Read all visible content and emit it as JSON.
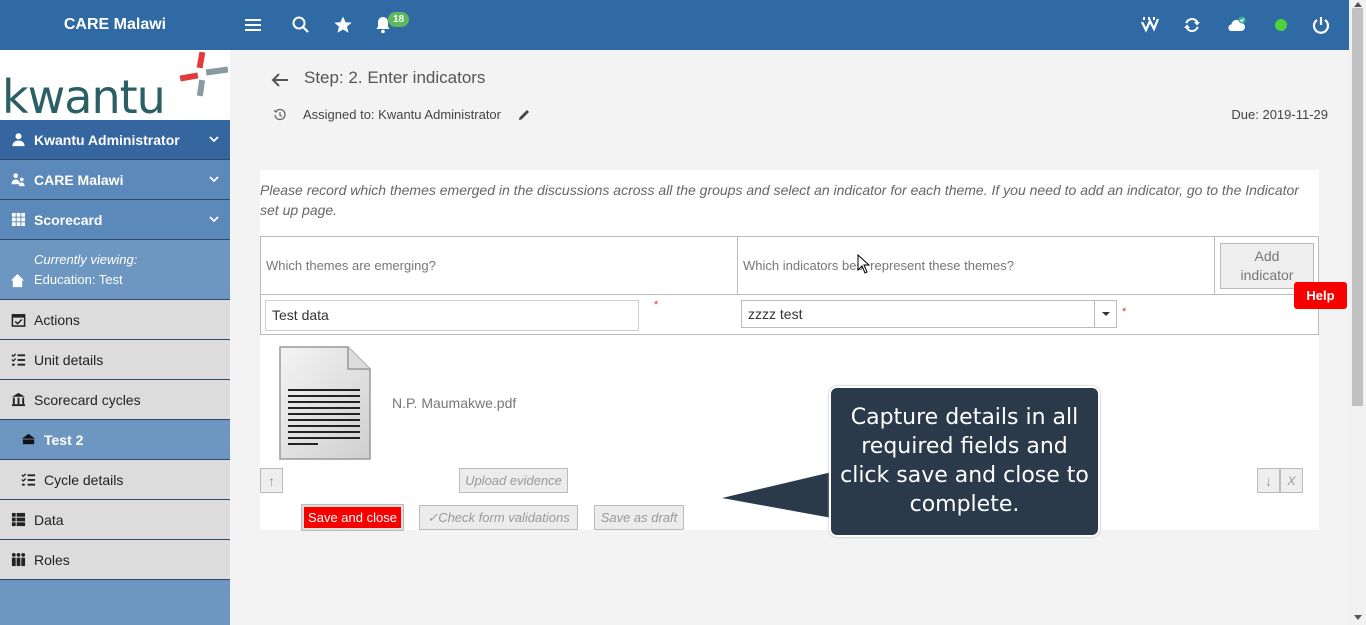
{
  "app": {
    "title": "CARE Malawi",
    "notification_count": "18",
    "status_color": "#4fd13a"
  },
  "brand_colors": {
    "topbar": "#2f6aa5",
    "primary_button": "#f80000"
  },
  "sidebar": {
    "logo_text": "kwantu",
    "user": "Kwantu Administrator",
    "org": "CARE Malawi",
    "module": "Scorecard",
    "viewing_label": "Currently viewing:",
    "viewing_value": "Education: Test",
    "items": [
      {
        "label": "Actions",
        "icon": "calendar-check-icon"
      },
      {
        "label": "Unit details",
        "icon": "list-check-icon"
      },
      {
        "label": "Scorecard cycles",
        "icon": "cycles-icon"
      },
      {
        "label": "Test 2",
        "icon": "cycle-item-icon"
      },
      {
        "label": "Cycle details",
        "icon": "list-check-icon"
      },
      {
        "label": "Data",
        "icon": "data-list-icon"
      },
      {
        "label": "Roles",
        "icon": "people-icon"
      }
    ]
  },
  "step": {
    "title": "Step: 2. Enter indicators",
    "assigned": "Assigned to: Kwantu Administrator",
    "due": "Due: 2019-11-29"
  },
  "form": {
    "instructions": "Please record which themes emerged in the discussions across all the groups and select an indicator for each theme. If you need to add an indicator, go to the Indicator set up page.",
    "col_themes": "Which themes are emerging?",
    "col_indicators": "Which indicators best represent these themes?",
    "add_indicator_line1": "Add",
    "add_indicator_line2": "indicator",
    "theme_value": "Test data",
    "indicator_value": "zzzz test",
    "required_mark": "*",
    "filename": "N.P. Maumakwe.pdf",
    "up": "↑",
    "down": "↓",
    "remove": "X",
    "upload": "Upload evidence",
    "save_close": "Save and close",
    "check": "✓Check form validations",
    "draft": "Save as draft"
  },
  "help": "Help",
  "callout": {
    "line1": "Capture details in all",
    "line2": "required fields and",
    "line3": "click save and close to",
    "line4": "complete."
  }
}
